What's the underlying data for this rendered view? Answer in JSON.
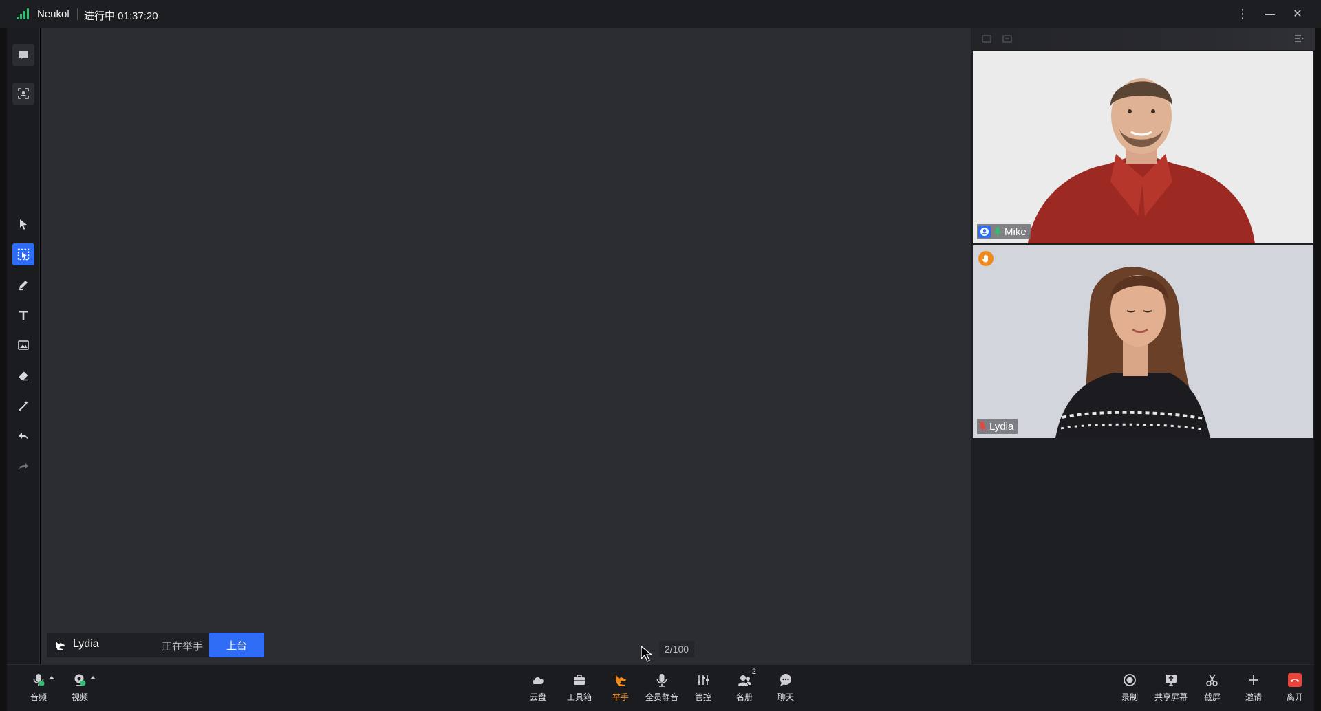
{
  "titlebar": {
    "app_name": "Neukol",
    "status": "进行中 01:37:20",
    "more_label": "⋮",
    "minimize_label": "—",
    "close_label": "✕"
  },
  "left_toolbar": {
    "tools": [
      "chat-icon",
      "focus-icon",
      "pointer-icon",
      "select-icon",
      "pen-icon",
      "text-icon",
      "image-icon",
      "eraser-icon",
      "magic-wand-icon",
      "undo-icon",
      "redo-icon"
    ],
    "active_tool": "select-icon"
  },
  "participants": [
    {
      "name": "Mike",
      "role_icon": "host-icon",
      "mic_on": true
    },
    {
      "name": "Lydia",
      "mic_on": false,
      "hand_raised": true
    }
  ],
  "hand_notice": {
    "name": "Lydia",
    "status": "正在举手",
    "action_label": "上台"
  },
  "page_counter": "2/100",
  "bottom_toolbar": {
    "left": [
      {
        "label": "音频",
        "icon": "microphone-icon"
      },
      {
        "label": "视频",
        "icon": "camera-icon"
      }
    ],
    "center": [
      {
        "label": "云盘",
        "icon": "cloud-icon"
      },
      {
        "label": "工具箱",
        "icon": "toolbox-icon"
      },
      {
        "label": "举手",
        "icon": "raise-hand-icon"
      },
      {
        "label": "全员静音",
        "icon": "mute-all-icon"
      },
      {
        "label": "管控",
        "icon": "controls-icon"
      },
      {
        "label": "名册",
        "icon": "roster-icon",
        "count": "2"
      },
      {
        "label": "聊天",
        "icon": "chat-bubble-icon"
      }
    ],
    "right": [
      {
        "label": "录制",
        "icon": "record-icon"
      },
      {
        "label": "共享屏幕",
        "icon": "share-screen-icon"
      },
      {
        "label": "截屏",
        "icon": "screenshot-icon"
      },
      {
        "label": "邀请",
        "icon": "invite-icon"
      },
      {
        "label": "离开",
        "icon": "leave-icon"
      }
    ]
  },
  "colors": {
    "accent": "#2f6cf6",
    "hand_orange": "#f08a1d",
    "leave_red": "#e8443a",
    "signal_green": "#2fbf71"
  }
}
